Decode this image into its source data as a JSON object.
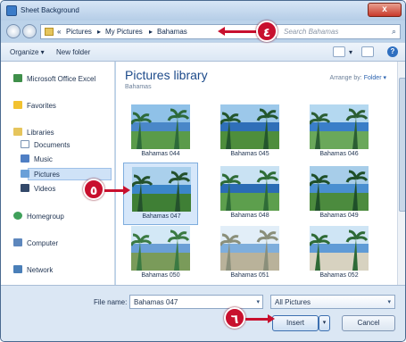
{
  "window": {
    "title": "Sheet Background",
    "close_symbol": "x"
  },
  "address": {
    "prefix": "«",
    "crumbs": [
      "Pictures",
      "My Pictures",
      "Bahamas"
    ],
    "separator": "▸",
    "search_placeholder": "Search Bahamas"
  },
  "toolbar": {
    "organize_label": "Organize ▾",
    "new_folder_label": "New folder",
    "views_dd": "▾",
    "help": "?"
  },
  "nav": {
    "items": [
      {
        "label": "Microsoft Office Excel"
      },
      {
        "label": "Favorites"
      },
      {
        "label": "Libraries"
      },
      {
        "label": "Documents"
      },
      {
        "label": "Music"
      },
      {
        "label": "Pictures"
      },
      {
        "label": "Videos"
      },
      {
        "label": "Homegroup"
      },
      {
        "label": "Computer"
      },
      {
        "label": "Network"
      }
    ]
  },
  "library": {
    "title": "Pictures library",
    "subtitle": "Bahamas",
    "arrange_label": "Arrange by:",
    "arrange_value": "Folder ▾"
  },
  "thumbnails": [
    {
      "caption": "Bahamas 044"
    },
    {
      "caption": "Bahamas 045"
    },
    {
      "caption": "Bahamas 046"
    },
    {
      "caption": "Bahamas 047"
    },
    {
      "caption": "Bahamas 048"
    },
    {
      "caption": "Bahamas 049"
    },
    {
      "caption": "Bahamas 050"
    },
    {
      "caption": "Bahamas 051"
    },
    {
      "caption": "Bahamas 052"
    }
  ],
  "bottom": {
    "file_name_label": "File name:",
    "file_name_value": "Bahamas 047",
    "filter_value": "All Pictures",
    "insert_label": "Insert",
    "cancel_label": "Cancel"
  },
  "callouts": {
    "step4": "٤",
    "step5": "٥",
    "step6": "٦"
  },
  "colors": {
    "callout": "#c8102e",
    "accent": "#2d64b0"
  }
}
